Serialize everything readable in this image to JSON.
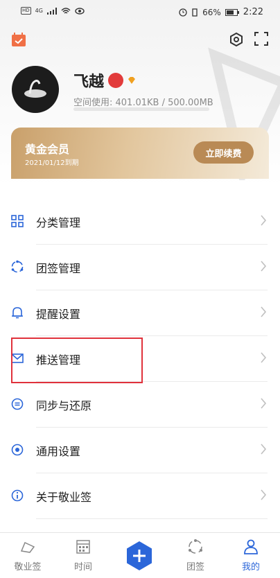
{
  "status_bar": {
    "network": "4G",
    "battery": "66%",
    "time": "2:22"
  },
  "profile": {
    "username": "飞越",
    "storage_label": "空间使用: 401.01KB / 500.00MB",
    "storage_fraction": 0.0008
  },
  "member_card": {
    "title": "黄金会员",
    "expiry": "2021/01/12到期",
    "renew_label": "立即续费"
  },
  "menu": [
    {
      "label": "分类管理",
      "icon": "grid-icon"
    },
    {
      "label": "团签管理",
      "icon": "team-circle-icon"
    },
    {
      "label": "提醒设置",
      "icon": "bell-icon"
    },
    {
      "label": "推送管理",
      "icon": "mail-icon"
    },
    {
      "label": "同步与还原",
      "icon": "sync-icon"
    },
    {
      "label": "通用设置",
      "icon": "radio-dot-icon"
    },
    {
      "label": "关于敬业签",
      "icon": "info-icon"
    }
  ],
  "bottom_nav": [
    {
      "label": "敬业签",
      "icon": "notes-icon",
      "active": false
    },
    {
      "label": "时间",
      "icon": "calendar-icon",
      "active": false
    },
    {
      "label": "团签",
      "icon": "team-icon",
      "active": false
    },
    {
      "label": "我的",
      "icon": "person-icon",
      "active": true
    }
  ],
  "colors": {
    "accent": "#2b66d9",
    "gold": "#c9a06b",
    "highlight_box": "#e0313b"
  }
}
